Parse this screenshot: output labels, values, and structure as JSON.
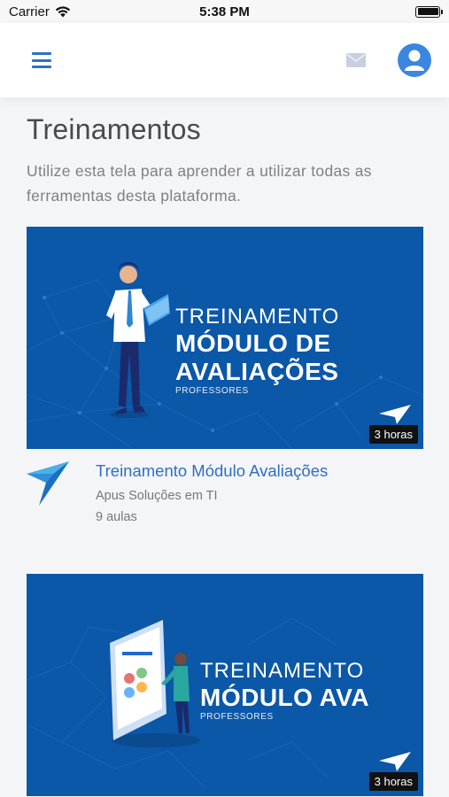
{
  "status_bar": {
    "carrier": "Carrier",
    "time": "5:38 PM"
  },
  "header": {
    "menu_icon": "hamburger-icon",
    "mail_icon": "mail-icon",
    "profile_icon": "user-avatar-icon",
    "accent": "#2f6fc4"
  },
  "page": {
    "title": "Treinamentos",
    "subtitle": "Utilize esta tela para aprender a utilizar todas as ferramentas desta plataforma."
  },
  "courses": [
    {
      "banner_line1": "TREINAMENTO",
      "banner_line2a": "MÓDULO DE",
      "banner_line2b": "AVALIAÇÕES",
      "banner_line3": "PROFESSORES",
      "duration": "3 horas",
      "title": "Treinamento Módulo Avaliações",
      "author": "Apus Soluções em TI",
      "lessons": "9 aulas"
    },
    {
      "banner_line1": "TREINAMENTO",
      "banner_line2a": "MÓDULO AVA",
      "banner_line3": "PROFESSORES",
      "duration": "3 horas"
    }
  ],
  "colors": {
    "banner_bg": "#0b57a8",
    "link": "#2f6fc4",
    "text_muted": "#808080"
  }
}
